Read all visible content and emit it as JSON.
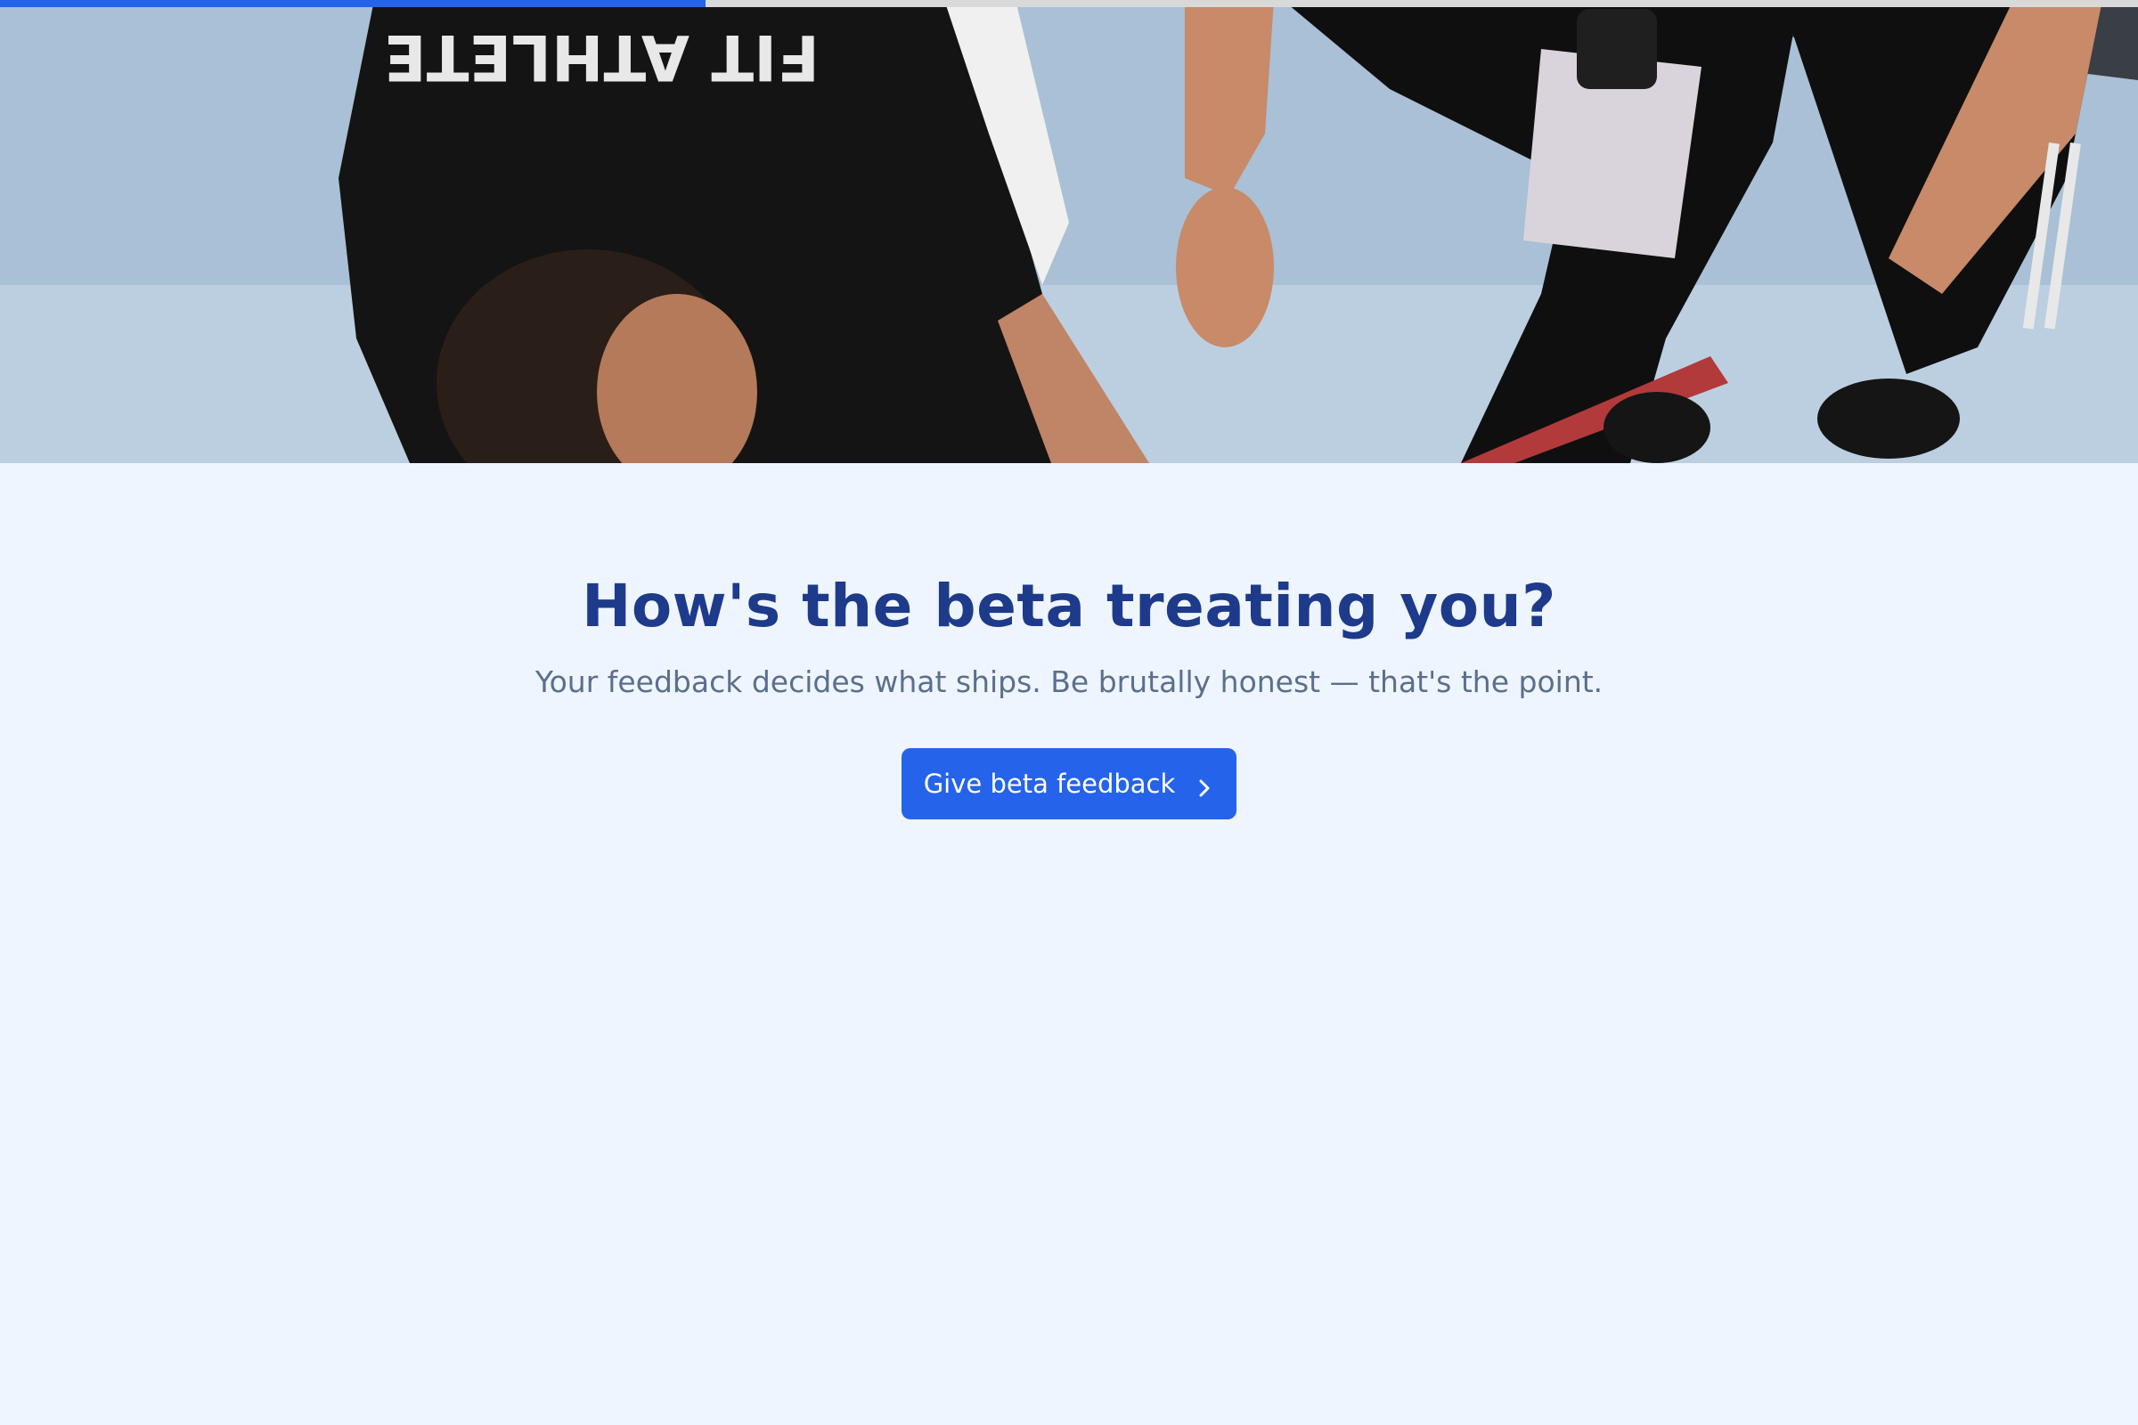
{
  "progress": {
    "fraction": 0.33,
    "fill_color": "#2563eb"
  },
  "hero": {
    "image": "athlete-fitness-photo"
  },
  "feedback": {
    "headline": "How's the beta treating you?",
    "subtext": "Your feedback decides what ships. Be brutally honest — that's the point.",
    "button_label": "Give beta feedback",
    "button_icon": "chevron-right-icon"
  },
  "colors": {
    "background": "#eef5ff",
    "headline": "#1e3a8a",
    "subtext": "#5b6f8c",
    "accent": "#2563eb"
  }
}
